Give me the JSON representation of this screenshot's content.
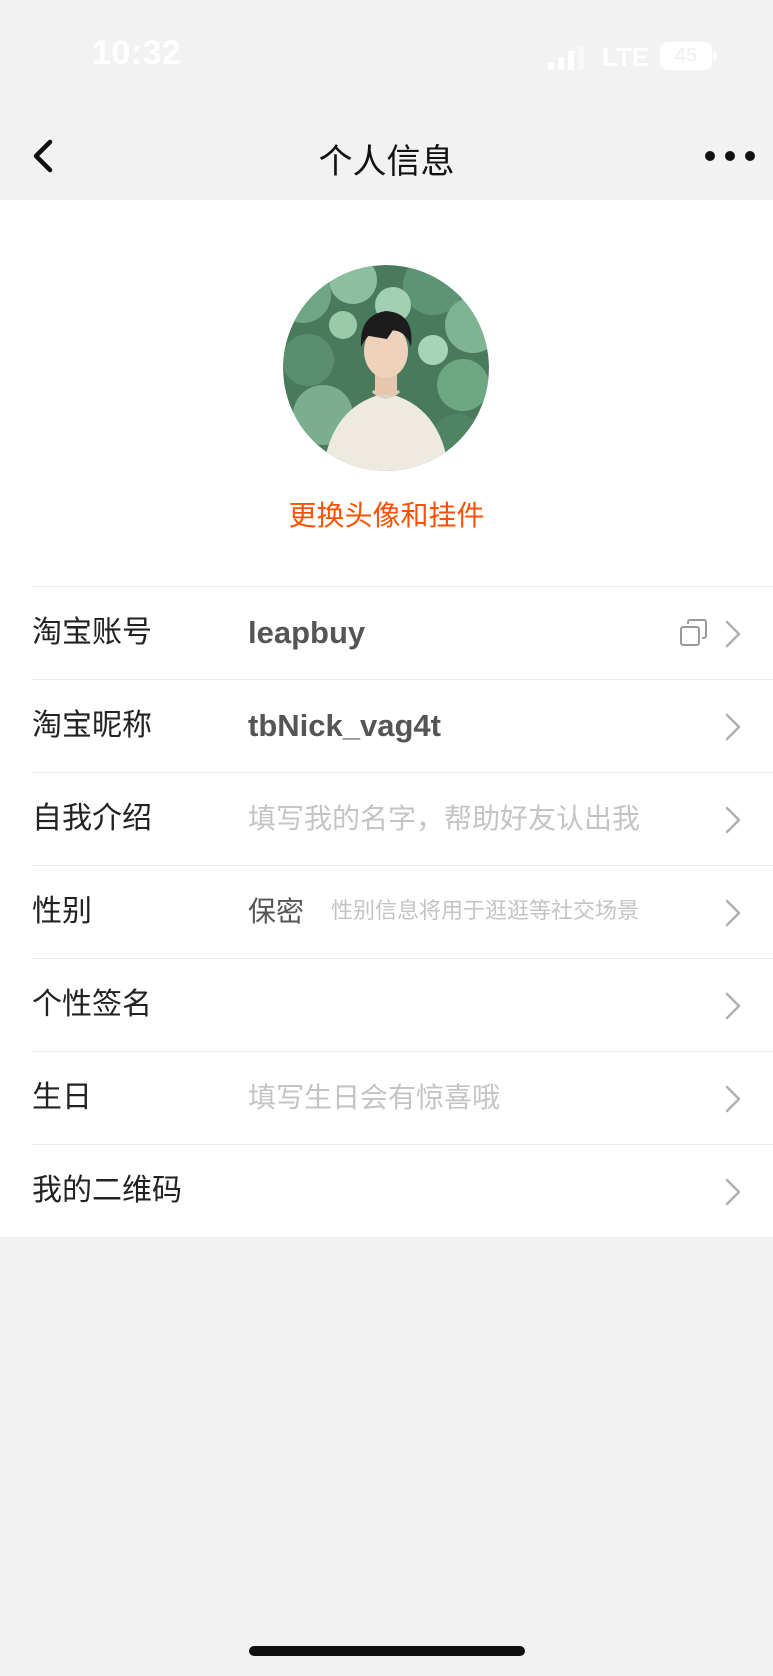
{
  "status_bar": {
    "time": "10:32",
    "network": "LTE",
    "battery": "45"
  },
  "nav": {
    "title": "个人信息",
    "back_icon": "chevron-left-icon",
    "more_icon": "more-dots-icon"
  },
  "profile": {
    "change_avatar_label": "更换头像和挂件"
  },
  "rows": {
    "account": {
      "label": "淘宝账号",
      "value": "leapbuy"
    },
    "nickname": {
      "label": "淘宝昵称",
      "value": "tbNick_vag4t"
    },
    "intro": {
      "label": "自我介绍",
      "placeholder": "填写我的名字，帮助好友认出我"
    },
    "gender": {
      "label": "性别",
      "value": "保密",
      "hint": "性别信息将用于逛逛等社交场景"
    },
    "signature": {
      "label": "个性签名"
    },
    "birthday": {
      "label": "生日",
      "placeholder": "填写生日会有惊喜哦"
    },
    "qrcode": {
      "label": "我的二维码"
    }
  },
  "colors": {
    "accent": "#ff5000",
    "background": "#f2f2f2",
    "card": "#ffffff",
    "placeholder": "#c4c4c4"
  }
}
